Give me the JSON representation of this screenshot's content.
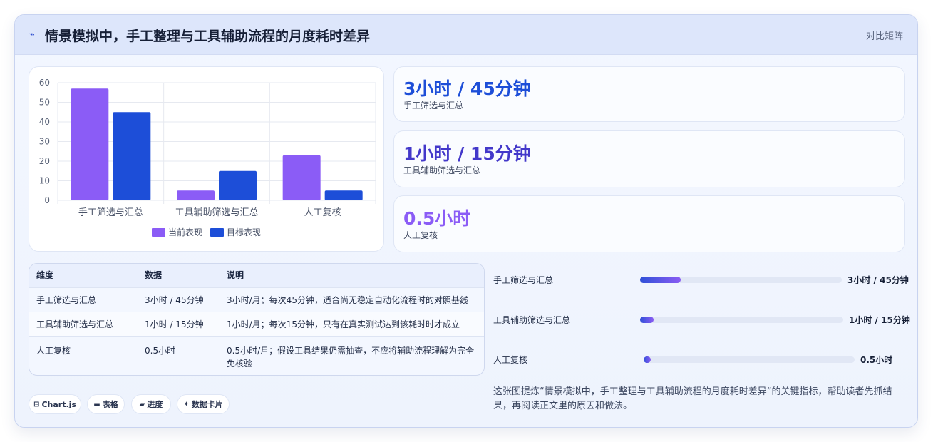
{
  "header": {
    "icon": "trend-icon",
    "title": "情景模拟中，手工整理与工具辅助流程的月度耗时差异",
    "tag": "对比矩阵"
  },
  "chart_data": {
    "type": "bar",
    "categories": [
      "手工筛选与汇总",
      "工具辅助筛选与汇总",
      "人工复核"
    ],
    "series": [
      {
        "name": "当前表现",
        "values": [
          57,
          5,
          23
        ],
        "color": "#8b5cf6"
      },
      {
        "name": "目标表现",
        "values": [
          45,
          15,
          5
        ],
        "color": "#1d4ed8"
      }
    ],
    "ylim": [
      0,
      60
    ],
    "yticks": [
      "0",
      "10",
      "20",
      "30",
      "40",
      "50",
      "60"
    ],
    "legend": "bottom",
    "grid": true
  },
  "stats": [
    {
      "value": "3小时 / 45分钟",
      "label": "手工筛选与汇总",
      "color": "#1d4ed8"
    },
    {
      "value": "1小时 / 15分钟",
      "label": "工具辅助筛选与汇总",
      "color": "#4338ca"
    },
    {
      "value": "0.5小时",
      "label": "人工复核",
      "color": "#8b5cf6"
    }
  ],
  "table": {
    "headers": [
      "维度",
      "数据",
      "说明"
    ],
    "rows": [
      {
        "dim": "手工筛选与汇总",
        "data": "3小时 / 45分钟",
        "note": "3小时/月；每次45分钟，适合尚无稳定自动化流程时的对照基线"
      },
      {
        "dim": "工具辅助筛选与汇总",
        "data": "1小时 / 15分钟",
        "note": "1小时/月；每次15分钟，只有在真实测试达到该耗时时才成立"
      },
      {
        "dim": "人工复核",
        "data": "0.5小时",
        "note_line1": "0.5小时/月；假设工具结果仍需抽查，不应将辅助流程理解为完全",
        "note_line2": "免核验"
      }
    ]
  },
  "progress": [
    {
      "label": "手工筛选与汇总",
      "value": "3小时 / 45分钟",
      "fraction": 0.2
    },
    {
      "label": "工具辅助筛选与汇总",
      "value": "1小时 / 15分钟",
      "fraction": 0.067
    },
    {
      "label": "人工复核",
      "value": "0.5小时",
      "fraction": 0.033
    }
  ],
  "chips": [
    {
      "icon": "chart-icon",
      "glyph": "⊟",
      "label": "Chart.js"
    },
    {
      "icon": "table-icon",
      "glyph": "▬",
      "label": "表格"
    },
    {
      "icon": "progress-icon",
      "glyph": "▰",
      "label": "进度"
    },
    {
      "icon": "sparkle-icon",
      "glyph": "✦",
      "label": "数据卡片"
    }
  ],
  "summary": "这张图提炼“情景模拟中，手工整理与工具辅助流程的月度耗时差异”的关键指标，帮助读者先抓结果，再阅读正文里的原因和做法。"
}
